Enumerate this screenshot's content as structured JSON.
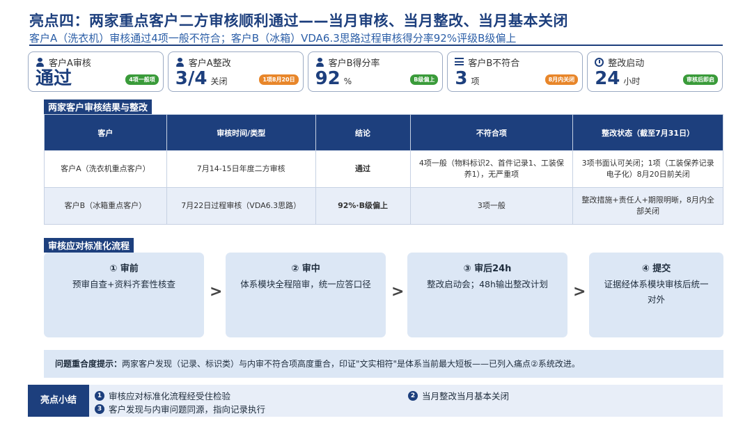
{
  "header": {
    "title": "亮点四：两家重点客户二方审核顺利通过——当月审核、当月整改、当月基本关闭",
    "subtitle": "客户A（洗衣机）审核通过4项一般不符合；客户B（冰箱）VDA6.3思路过程审核得分率92%评级B级偏上"
  },
  "kpis": [
    {
      "label": "客户A审核",
      "value": "通过",
      "unit": "",
      "badge": "4项一般项",
      "icon": "person-icon",
      "badge_color": "#3a9b3a"
    },
    {
      "label": "客户A整改",
      "value": "3/4",
      "unit": "关闭",
      "badge": "1项8月20日",
      "icon": "person-check-icon",
      "badge_color": "#e8862a"
    },
    {
      "label": "客户B得分率",
      "value": "92",
      "unit": "%",
      "badge": "B级偏上",
      "icon": "person-icon",
      "badge_color": "#3a9b3a"
    },
    {
      "label": "客户B不符合",
      "value": "3",
      "unit": "项",
      "badge": "8月内关闭",
      "icon": "checklist-icon",
      "badge_color": "#e8862a"
    },
    {
      "label": "整改启动",
      "value": "24",
      "unit": "小时",
      "badge": "审核后即启",
      "icon": "stopwatch-icon",
      "badge_color": "#3a9b3a"
    }
  ],
  "table_section": {
    "tag": "两家客户审核结果与整改",
    "headers": [
      "客户",
      "审核时间/类型",
      "结论",
      "不符合项",
      "整改状态（截至7月31日）"
    ],
    "rows": [
      [
        "客户A（洗衣机重点客户）",
        "7月14-15日年度二方审核",
        "通过",
        "4项一般（物料标识2、首件记录1、工装保养1），无严重项",
        "3项书面认可关闭；1项（工装保养记录电子化）8月20日前关闭"
      ],
      [
        "客户B（冰箱重点客户）",
        "7月22日过程审核（VDA6.3思路）",
        "92%·B级偏上",
        "3项一般",
        "整改措施+责任人+期限明晰，8月内全部关闭"
      ]
    ]
  },
  "flow_section": {
    "tag": "审核应对标准化流程",
    "steps": [
      {
        "title": "① 审前",
        "desc": "预审自查+资料齐套性核查"
      },
      {
        "title": "② 审中",
        "desc": "体系模块全程陪审，统一应答口径"
      },
      {
        "title": "③ 审后24h",
        "desc": "整改启动会；48h输出整改计划"
      },
      {
        "title": "④ 提交",
        "desc": "证据经体系模块审核后统一对外"
      }
    ],
    "arrow": ">"
  },
  "hint": {
    "label": "问题重合度提示：",
    "text": "两家客户发现（记录、标识类）与内审不符合项高度重合，印证\"文实相符\"是体系当前最大短板——已列入痛点②系统改进。"
  },
  "summary": {
    "tag": "亮点小结",
    "items": [
      {
        "num": "1",
        "text": "审核应对标准化流程经受住检验"
      },
      {
        "num": "2",
        "text": "当月整改当月基本关闭"
      },
      {
        "num": "3",
        "text": "客户发现与内审问题同源，指向记录执行"
      }
    ]
  },
  "colors": {
    "brand": "#1d3f7d",
    "accent": "#2b5ea7",
    "pass_green": "#3a9b3a",
    "warn_orange": "#e8862a",
    "panel": "#dce7f5"
  }
}
